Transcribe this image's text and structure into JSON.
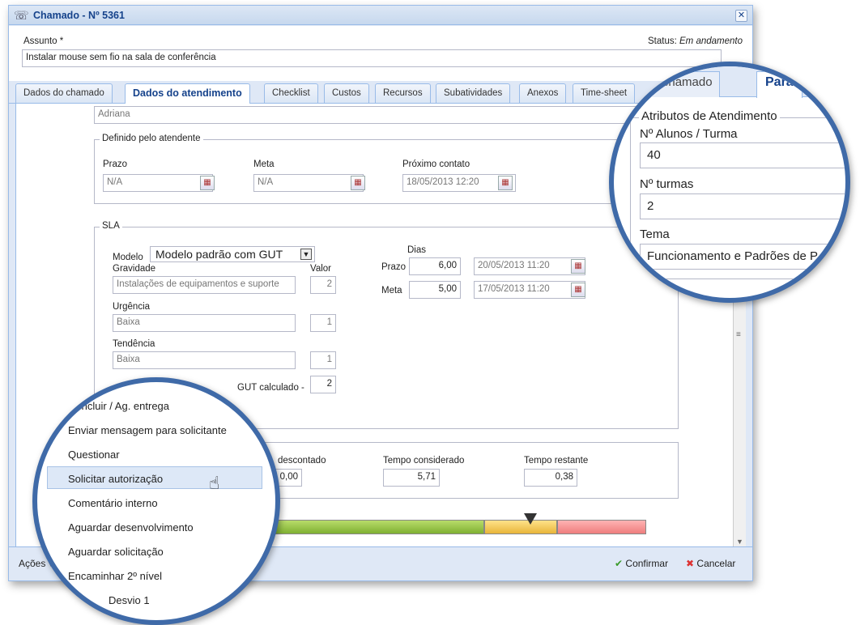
{
  "window": {
    "title": "Chamado - Nº 5361"
  },
  "assunto": {
    "label": "Assunto *",
    "value": "Instalar mouse sem fio na sala de conferência"
  },
  "status": {
    "label": "Status:",
    "value": "Em andamento"
  },
  "tabs": [
    "Dados do chamado",
    "Dados do atendimento",
    "Checklist",
    "Custos",
    "Recursos",
    "Subatividades",
    "Anexos",
    "Time-sheet"
  ],
  "attendant": "Adriana",
  "definido": {
    "legend": "Definido pelo atendente",
    "prazo_label": "Prazo",
    "prazo_value": "N/A",
    "meta_label": "Meta",
    "meta_value": "N/A",
    "proximo_label": "Próximo contato",
    "proximo_value": "18/05/2013 12:20"
  },
  "sla": {
    "legend": "SLA",
    "modelo_label": "Modelo",
    "modelo_value": "Modelo padrão com GUT",
    "gravidade_label": "Gravidade",
    "gravidade_value": "Instalações de equipamentos e suporte",
    "gravidade_num": "2",
    "valor_label": "Valor",
    "urgencia_label": "Urgência",
    "urgencia_value": "Baixa",
    "urgencia_num": "1",
    "tendencia_label": "Tendência",
    "tendencia_value": "Baixa",
    "tendencia_num": "1",
    "gut_label": "GUT calculado -",
    "gut_value": "2",
    "dias_label": "Dias",
    "prazo_label": "Prazo",
    "prazo_dias": "6,00",
    "prazo_date": "20/05/2013 11:20",
    "meta_label": "Meta",
    "meta_dias": "5,00",
    "meta_date": "17/05/2013 11:20"
  },
  "tempo": {
    "descontado_label": "descontado",
    "descontado_value": "0,00",
    "considerado_label": "Tempo considerado",
    "considerado_value": "5,71",
    "restante_label": "Tempo restante",
    "restante_value": "0,38"
  },
  "bottom": {
    "acoes": "Ações",
    "confirmar": "Confirmar",
    "cancelar": "Cancelar"
  },
  "zoom_right": {
    "tab1": "os do chamado",
    "tab2": "Para",
    "legend": "Atributos de Atendimento",
    "alunos_label": "Nº Alunos / Turma",
    "alunos_value": "40",
    "turmas_label": "Nº turmas",
    "turmas_value": "2",
    "tema_label": "Tema",
    "tema_value": "Funcionamento e Padrões de P"
  },
  "zoom_left_menu": [
    "Concluir / Ag. entrega",
    "Enviar mensagem para solicitante",
    "Questionar",
    "Solicitar autorização",
    "Comentário interno",
    "Aguardar desenvolvimento",
    "Aguardar solicitação",
    "Encaminhar 2º nível",
    "Desvio 1"
  ],
  "colors": {
    "accent": "#3f6aa8",
    "bar_green": "#8fbf3a",
    "bar_yellow": "#efc54a",
    "bar_red": "#ef8c8c"
  }
}
